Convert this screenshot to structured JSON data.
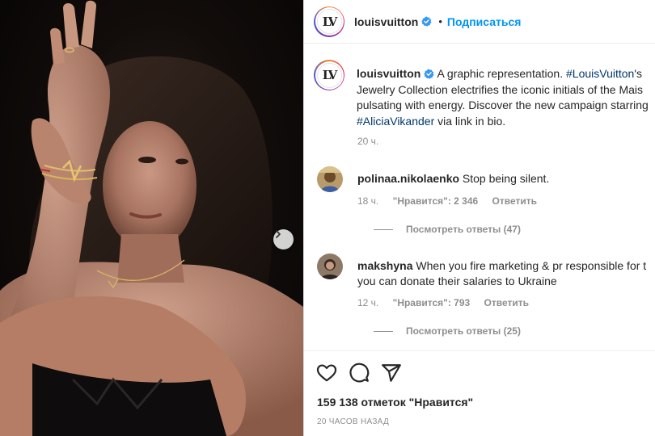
{
  "post": {
    "username": "louisvuitton",
    "follow_label": "Подписаться",
    "dot": "•",
    "logo_text": "LV",
    "caption_lines": [
      "A graphic representation. ",
      "Jewelry Collection electrifies the iconic initials of the Mais",
      "pulsating with energy. Discover the new campaign starring",
      " via link in bio."
    ],
    "caption_tag_1": "#LouisVuitton",
    "caption_tag_1_suffix": "'s",
    "caption_tag_2": "#AliciaVikander",
    "caption_time": "20 ч."
  },
  "comments": [
    {
      "username": "polinaa.nikolaenko",
      "text": "Stop being silent.",
      "time": "18 ч.",
      "likes": "\"Нравится\": 2 346",
      "reply": "Ответить",
      "view_replies": "Посмотреть ответы (47)"
    },
    {
      "username": "makshyna",
      "text_line1": "When you fire marketing & pr responsible for t",
      "text_line2": "you can donate their salaries to Ukraine",
      "time": "12 ч.",
      "likes": "\"Нравится\": 793",
      "reply": "Ответить",
      "view_replies": "Посмотреть ответы (25)"
    }
  ],
  "footer": {
    "likes_count": "159 138 отметок \"Нравится\"",
    "posted": "20 ЧАСОВ НАЗАД"
  },
  "icons": [
    "verified-badge-icon",
    "chevron-right-icon",
    "heart-icon",
    "comment-icon",
    "share-icon"
  ],
  "colors": {
    "follow": "#0095f6",
    "hashtag": "#00376b",
    "muted": "#8e8e8e",
    "verified": "#3897f0"
  }
}
